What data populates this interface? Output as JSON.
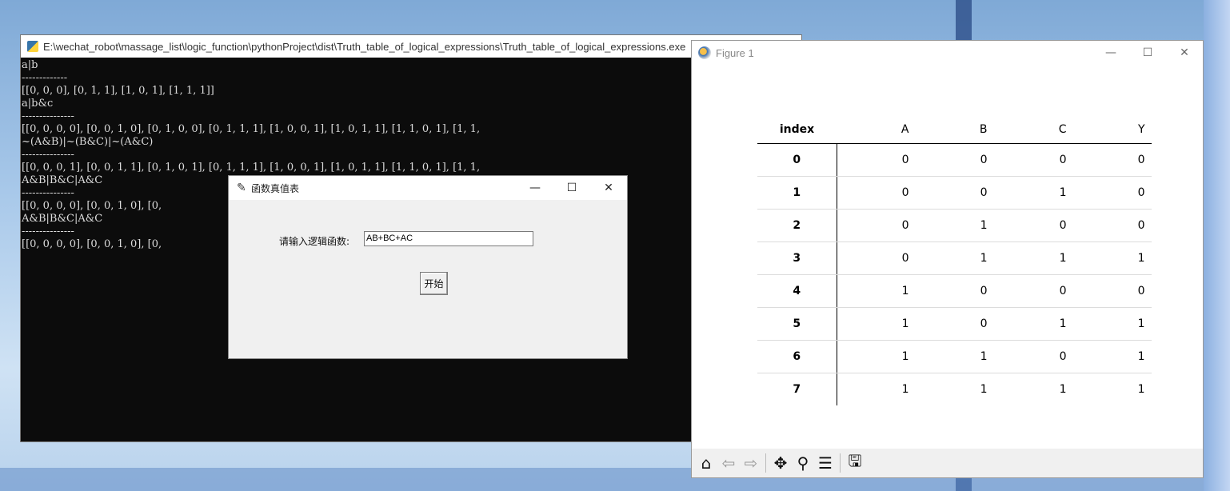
{
  "console": {
    "title": "E:\\wechat_robot\\massage_list\\logic_function\\pythonProject\\dist\\Truth_table_of_logical_expressions\\Truth_table_of_logical_expressions.exe",
    "output": "a|b\n-------------\n[[0, 0, 0], [0, 1, 1], [1, 0, 1], [1, 1, 1]]\na|b&c\n---------------\n[[0, 0, 0, 0], [0, 0, 1, 0], [0, 1, 0, 0], [0, 1, 1, 1], [1, 0, 0, 1], [1, 0, 1, 1], [1, 1, 0, 1], [1, 1,\n~(A&B)|~(B&C)|~(A&C)\n---------------\n[[0, 0, 0, 1], [0, 0, 1, 1], [0, 1, 0, 1], [0, 1, 1, 1], [1, 0, 0, 1], [1, 0, 1, 1], [1, 1, 0, 1], [1, 1,\nA&B|B&C|A&C\n---------------\n[[0, 0, 0, 0], [0, 0, 1, 0], [0,                                                                      1], [1, 1,\nA&B|B&C|A&C\n---------------\n[[0, 0, 0, 0], [0, 0, 1, 0], [0,                                                                      1], [1, 1,"
  },
  "dialog": {
    "title": "函数真值表",
    "prompt_label": "请输入逻辑函数:",
    "input_value": "AB+BC+AC",
    "start_button": "开始"
  },
  "window_controls": {
    "minimize": "—",
    "maximize": "☐",
    "close": "✕"
  },
  "figure": {
    "title": "Figure 1",
    "table": {
      "headers": [
        "index",
        "A",
        "B",
        "C",
        "Y"
      ],
      "rows": [
        [
          "0",
          "0",
          "0",
          "0",
          "0"
        ],
        [
          "1",
          "0",
          "0",
          "1",
          "0"
        ],
        [
          "2",
          "0",
          "1",
          "0",
          "0"
        ],
        [
          "3",
          "0",
          "1",
          "1",
          "1"
        ],
        [
          "4",
          "1",
          "0",
          "0",
          "0"
        ],
        [
          "5",
          "1",
          "0",
          "1",
          "1"
        ],
        [
          "6",
          "1",
          "1",
          "0",
          "1"
        ],
        [
          "7",
          "1",
          "1",
          "1",
          "1"
        ]
      ]
    },
    "toolbar": {
      "home": "⌂",
      "back": "⇦",
      "forward": "⇨",
      "pan": "✥",
      "zoom": "⚲",
      "configure": "☰",
      "save": "🖫"
    }
  }
}
